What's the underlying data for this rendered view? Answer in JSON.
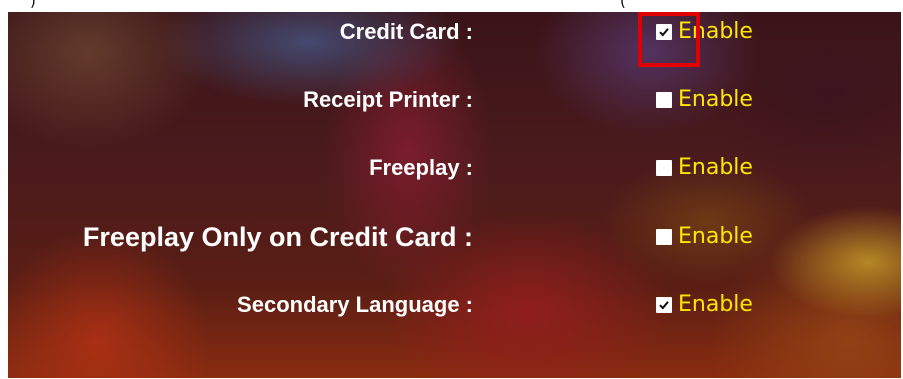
{
  "top_text": {
    "left": ")",
    "right": "("
  },
  "settings": [
    {
      "label": "Credit Card :",
      "option": "Enable",
      "checked": true
    },
    {
      "label": "Receipt Printer :",
      "option": "Enable",
      "checked": false
    },
    {
      "label": "Freeplay :",
      "option": "Enable",
      "checked": false
    },
    {
      "label": "Freeplay Only on Credit Card :",
      "option": "Enable",
      "checked": false
    },
    {
      "label": "Secondary Language :",
      "option": "Enable",
      "checked": true
    }
  ],
  "colors": {
    "label": "#ffffff",
    "option": "#ffe600",
    "highlight": "#e00000"
  }
}
